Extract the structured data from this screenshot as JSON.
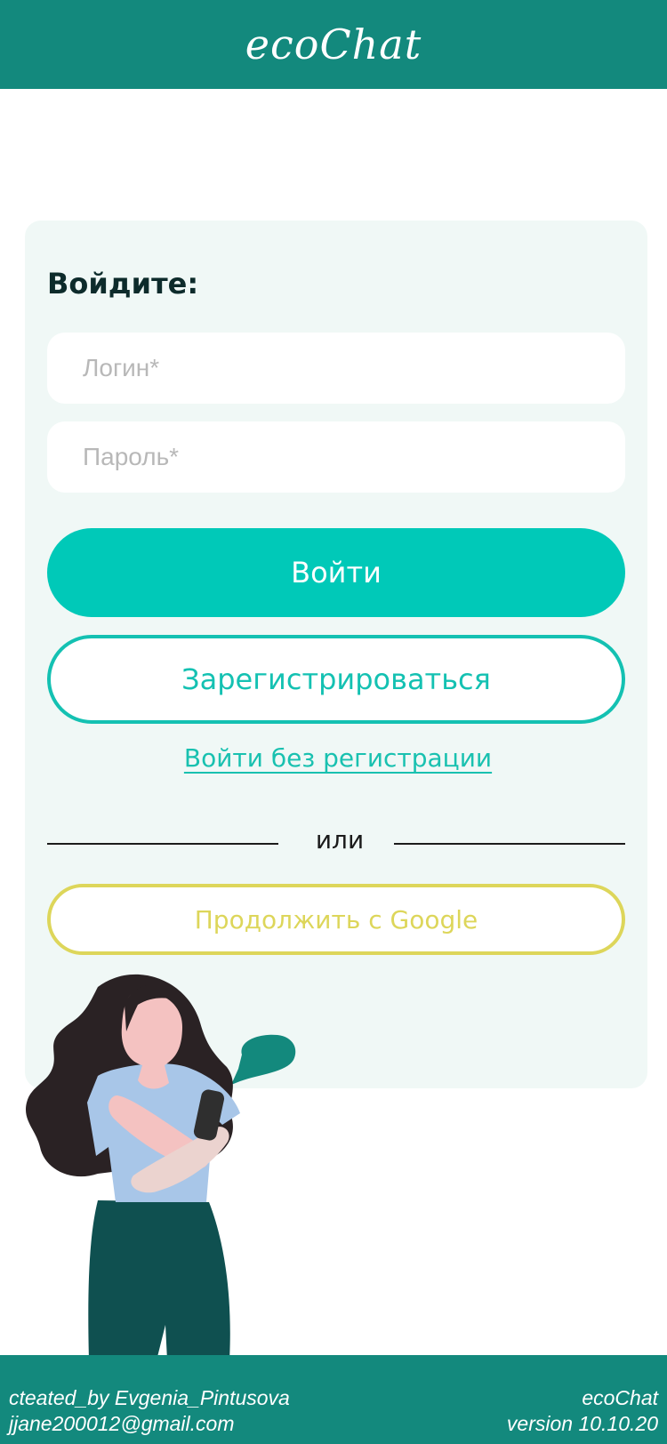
{
  "header": {
    "title": "ecoChat"
  },
  "login": {
    "heading": "Войдите:",
    "login_placeholder": "Логин*",
    "password_placeholder": "Пароль*",
    "submit_label": "Войти",
    "register_label": "Зарегистрироваться",
    "guest_link": "Войти без регистрации",
    "divider_text": "или",
    "google_label": "Продолжить с Google"
  },
  "illustration": {
    "icon": "woman-with-phone-illustration",
    "bubble_icon": "speech-bubble-icon"
  },
  "footer": {
    "credit": "cteated_by Evgenia_Pintusova",
    "email": "jjane200012@gmail.com",
    "app_name": "ecoChat",
    "version": "version 10.10.20"
  },
  "colors": {
    "brand": "#13897d",
    "accent": "#00c9b8",
    "google": "#ddd65a",
    "card_bg": "#f0f8f6"
  }
}
